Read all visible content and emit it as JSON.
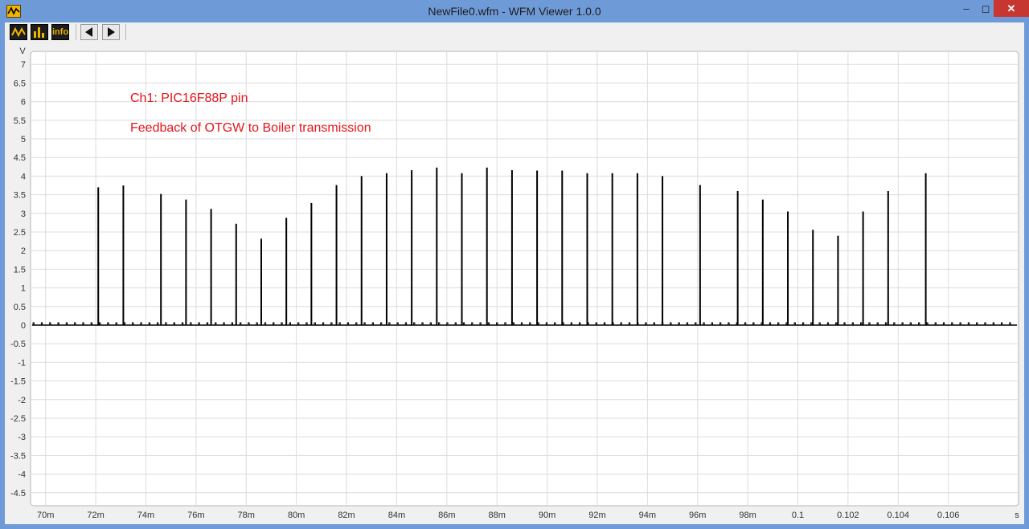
{
  "window": {
    "title": "NewFile0.wfm - WFM Viewer 1.0.0",
    "controls": {
      "minimize": "‒",
      "maximize": "◻",
      "close": "✕"
    }
  },
  "toolbar": {
    "buttons": [
      {
        "name": "waveform-view-icon"
      },
      {
        "name": "spectrum-view-icon"
      },
      {
        "name": "info-button",
        "label": "info"
      },
      {
        "name": "previous-arrow-icon"
      },
      {
        "name": "next-arrow-icon"
      }
    ]
  },
  "chart_data": {
    "type": "line",
    "ylabel": "V",
    "xlabel": "s",
    "ylim": [
      -4.85,
      7.35
    ],
    "xlim": [
      0.0694,
      0.1088
    ],
    "grid": true,
    "colors": {
      "trace": "#000000",
      "annotation": "#e8141a",
      "grid": "#dcdcdc",
      "plot_bg": "#ffffff"
    },
    "annotations": [
      "Ch1: PIC16F88P pin",
      "Feedback of OTGW to Boiler transmission"
    ],
    "y_ticks": [
      "7",
      "6.5",
      "6",
      "5.5",
      "5",
      "4.5",
      "4",
      "3.5",
      "3",
      "2.5",
      "2",
      "1.5",
      "1",
      "0.5",
      "0",
      "-0.5",
      "-1",
      "-1.5",
      "-2",
      "-2.5",
      "-3",
      "-3.5",
      "-4",
      "-4.5"
    ],
    "x_ticks": [
      {
        "value": 0.07,
        "label": "70m"
      },
      {
        "value": 0.072,
        "label": "72m"
      },
      {
        "value": 0.074,
        "label": "74m"
      },
      {
        "value": 0.076,
        "label": "76m"
      },
      {
        "value": 0.078,
        "label": "78m"
      },
      {
        "value": 0.08,
        "label": "80m"
      },
      {
        "value": 0.082,
        "label": "82m"
      },
      {
        "value": 0.084,
        "label": "84m"
      },
      {
        "value": 0.086,
        "label": "86m"
      },
      {
        "value": 0.088,
        "label": "88m"
      },
      {
        "value": 0.09,
        "label": "90m"
      },
      {
        "value": 0.092,
        "label": "92m"
      },
      {
        "value": 0.094,
        "label": "94m"
      },
      {
        "value": 0.096,
        "label": "96m"
      },
      {
        "value": 0.098,
        "label": "98m"
      },
      {
        "value": 0.1,
        "label": "0.1"
      },
      {
        "value": 0.102,
        "label": "0.102"
      },
      {
        "value": 0.104,
        "label": "0.104"
      },
      {
        "value": 0.106,
        "label": "0.106"
      }
    ],
    "baseline_v": 0,
    "spikes": [
      {
        "t": 0.0721,
        "v": 3.7
      },
      {
        "t": 0.0731,
        "v": 3.75
      },
      {
        "t": 0.0746,
        "v": 3.52
      },
      {
        "t": 0.0756,
        "v": 3.37
      },
      {
        "t": 0.0766,
        "v": 3.12
      },
      {
        "t": 0.0776,
        "v": 2.72
      },
      {
        "t": 0.0786,
        "v": 2.32
      },
      {
        "t": 0.0796,
        "v": 2.88
      },
      {
        "t": 0.0806,
        "v": 3.28
      },
      {
        "t": 0.0816,
        "v": 3.76
      },
      {
        "t": 0.0826,
        "v": 4.0
      },
      {
        "t": 0.0836,
        "v": 4.08
      },
      {
        "t": 0.0846,
        "v": 4.16
      },
      {
        "t": 0.0856,
        "v": 4.23
      },
      {
        "t": 0.0866,
        "v": 4.08
      },
      {
        "t": 0.0876,
        "v": 4.23
      },
      {
        "t": 0.0886,
        "v": 4.16
      },
      {
        "t": 0.0896,
        "v": 4.15
      },
      {
        "t": 0.0906,
        "v": 4.15
      },
      {
        "t": 0.0916,
        "v": 4.08
      },
      {
        "t": 0.0926,
        "v": 4.08
      },
      {
        "t": 0.0936,
        "v": 4.08
      },
      {
        "t": 0.0946,
        "v": 4.0
      },
      {
        "t": 0.0961,
        "v": 3.76
      },
      {
        "t": 0.0976,
        "v": 3.6
      },
      {
        "t": 0.0986,
        "v": 3.37
      },
      {
        "t": 0.0996,
        "v": 3.05
      },
      {
        "t": 0.1006,
        "v": 2.56
      },
      {
        "t": 0.1016,
        "v": 2.4
      },
      {
        "t": 0.1026,
        "v": 3.05
      },
      {
        "t": 0.1036,
        "v": 3.6
      },
      {
        "t": 0.1051,
        "v": 4.08
      }
    ]
  }
}
